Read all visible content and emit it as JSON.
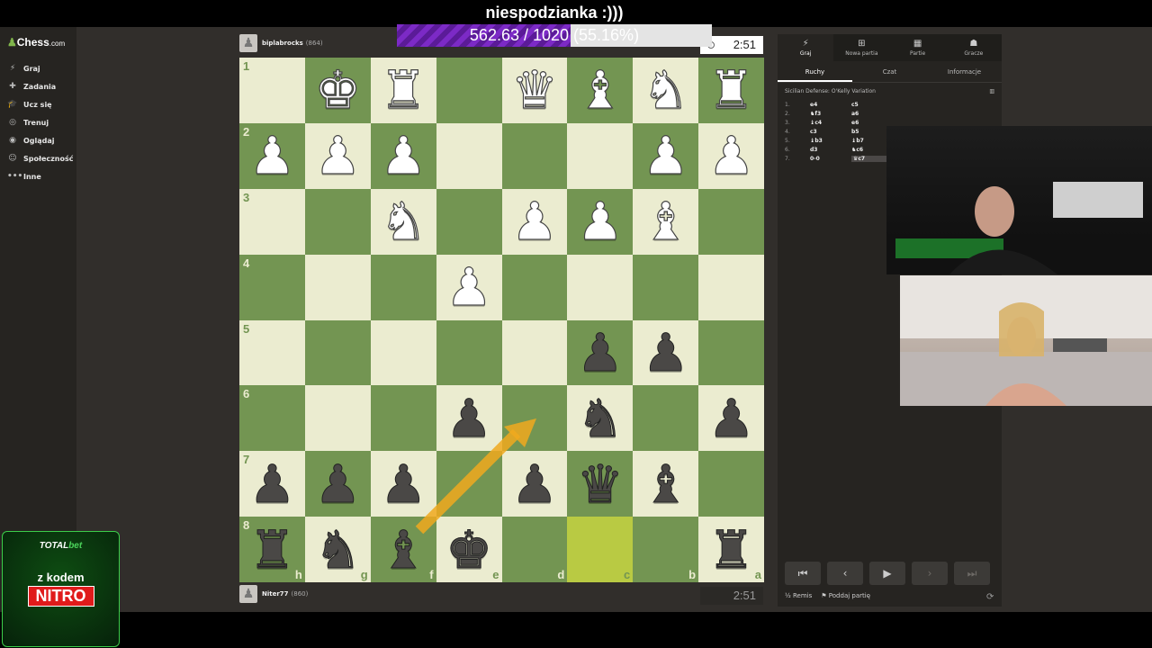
{
  "stream": {
    "title": "niespodzianka :)))",
    "goal_text": "562.63 / 1020 (55.16%)",
    "goal_fraction": 0.5516
  },
  "sidebar": {
    "logo": "Chess",
    "logo_suffix": ".com",
    "items": [
      {
        "label": "Graj",
        "icon": "lightning-icon"
      },
      {
        "label": "Zadania",
        "icon": "puzzle-icon"
      },
      {
        "label": "Ucz się",
        "icon": "graduation-icon"
      },
      {
        "label": "Trenuj",
        "icon": "target-icon"
      },
      {
        "label": "Oglądaj",
        "icon": "binoculars-icon"
      },
      {
        "label": "Społeczność",
        "icon": "community-icon"
      },
      {
        "label": "Inne",
        "icon": "more-icon"
      }
    ]
  },
  "players": {
    "top": {
      "name": "biplabrocks",
      "rating": "(864)",
      "clock": "2:51"
    },
    "bottom": {
      "name": "Niter77",
      "rating": "(860)",
      "clock": "2:51"
    }
  },
  "board": {
    "ranks": [
      "1",
      "2",
      "3",
      "4",
      "5",
      "6",
      "7",
      "8"
    ],
    "files": [
      "h",
      "g",
      "f",
      "e",
      "d",
      "c",
      "b",
      "a"
    ],
    "pieces": [
      [
        "",
        "wK",
        "wR",
        "",
        "wQ",
        "wB",
        "wN",
        "wR"
      ],
      [
        "wP",
        "wP",
        "wP",
        "",
        "",
        "",
        "wP",
        "wP"
      ],
      [
        "",
        "",
        "wN",
        "",
        "wP",
        "wP",
        "wB",
        ""
      ],
      [
        "",
        "",
        "",
        "wP",
        "",
        "",
        "",
        ""
      ],
      [
        "",
        "",
        "",
        "",
        "",
        "bP",
        "bP",
        ""
      ],
      [
        "",
        "",
        "",
        "bP",
        "",
        "bN",
        "",
        "bP"
      ],
      [
        "bP",
        "bP",
        "bP",
        "",
        "bP",
        "bQ",
        "bB",
        ""
      ],
      [
        "bR",
        "bN",
        "bB",
        "bK",
        "",
        "",
        "",
        "bR"
      ]
    ],
    "highlights": [
      "7-5",
      "8-5"
    ]
  },
  "panel": {
    "tabs": [
      {
        "label": "Graj",
        "icon": "lightning-icon"
      },
      {
        "label": "Nowa partia",
        "icon": "plus-icon"
      },
      {
        "label": "Partie",
        "icon": "board-icon"
      },
      {
        "label": "Gracze",
        "icon": "users-icon"
      }
    ],
    "subtabs": [
      "Ruchy",
      "Czat",
      "Informacje"
    ],
    "opening": "Sicilian Defense: O'Kelly Variation",
    "moves": [
      {
        "n": "1.",
        "w": "e4",
        "b": "c5"
      },
      {
        "n": "2.",
        "w": "♞f3",
        "b": "a6"
      },
      {
        "n": "3.",
        "w": "♝c4",
        "b": "e6"
      },
      {
        "n": "4.",
        "w": "c3",
        "b": "b5"
      },
      {
        "n": "5.",
        "w": "♝b3",
        "b": "♝b7"
      },
      {
        "n": "6.",
        "w": "d3",
        "b": "♞c6"
      },
      {
        "n": "7.",
        "w": "0-0",
        "b": "♛c7"
      }
    ],
    "draw_label": "½ Remis",
    "resign_label": "Poddaj partię"
  },
  "sponsor": {
    "brand_a": "TOTAL",
    "brand_b": "bet",
    "code_text": "z kodem",
    "code": "NITRO"
  }
}
